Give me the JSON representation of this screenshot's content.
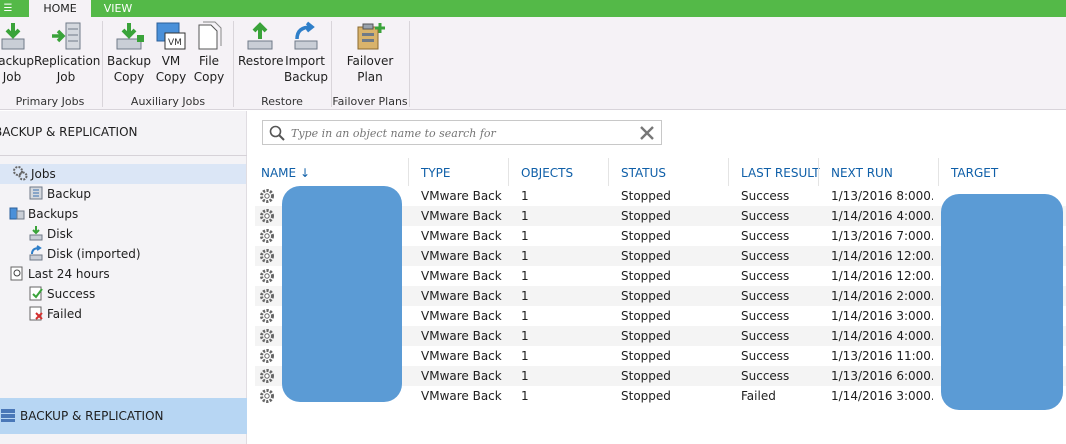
{
  "ribbon": {
    "tabs": [
      {
        "label": "HOME",
        "active": true
      },
      {
        "label": "VIEW",
        "active": false
      }
    ],
    "groups": [
      {
        "label": "Primary Jobs",
        "buttons": [
          {
            "line1": "Backup",
            "line2": "Job",
            "icon": "backup-job-icon"
          },
          {
            "line1": "Replication",
            "line2": "Job",
            "icon": "replication-job-icon"
          }
        ]
      },
      {
        "label": "Auxiliary Jobs",
        "buttons": [
          {
            "line1": "Backup",
            "line2": "Copy",
            "icon": "backup-copy-icon"
          },
          {
            "line1": "VM",
            "line2": "Copy",
            "icon": "vm-copy-icon"
          },
          {
            "line1": "File",
            "line2": "Copy",
            "icon": "file-copy-icon"
          }
        ]
      },
      {
        "label": "Restore",
        "buttons": [
          {
            "line1": "Restore",
            "line2": "",
            "icon": "restore-icon"
          },
          {
            "line1": "Import",
            "line2": "Backup",
            "icon": "import-backup-icon"
          }
        ]
      },
      {
        "label": "Failover Plans",
        "buttons": [
          {
            "line1": "Failover",
            "line2": "Plan",
            "icon": "failover-plan-icon"
          }
        ]
      }
    ]
  },
  "nav": {
    "title": "BACKUP & REPLICATION",
    "tree": [
      {
        "label": "Jobs",
        "icon": "jobs-icon",
        "selected": true
      },
      {
        "label": "Backup",
        "icon": "backup-icon"
      },
      {
        "label": "Backups",
        "icon": "backups-icon"
      },
      {
        "label": "Disk",
        "icon": "disk-icon"
      },
      {
        "label": "Disk (imported)",
        "icon": "disk-imported-icon"
      },
      {
        "label": "Last 24 hours",
        "icon": "last-24-hours-icon"
      },
      {
        "label": "Success",
        "icon": "success-icon"
      },
      {
        "label": "Failed",
        "icon": "failed-icon"
      }
    ],
    "bottom_label": "BACKUP & REPLICATION"
  },
  "search": {
    "placeholder": "Type in an object name to search for"
  },
  "grid": {
    "columns": [
      "NAME",
      "TYPE",
      "OBJECTS",
      "STATUS",
      "LAST RESULT",
      "NEXT RUN",
      "TARGET"
    ],
    "sort_indicator": "↓",
    "rows": [
      {
        "type": "VMware Back...",
        "objects": "1",
        "status": "Stopped",
        "last_result": "Success",
        "next_run": "1/13/2016 8:000..."
      },
      {
        "type": "VMware Back...",
        "objects": "1",
        "status": "Stopped",
        "last_result": "Success",
        "next_run": "1/14/2016 4:000..."
      },
      {
        "type": "VMware Back...",
        "objects": "1",
        "status": "Stopped",
        "last_result": "Success",
        "next_run": "1/13/2016 7:000..."
      },
      {
        "type": "VMware Back...",
        "objects": "1",
        "status": "Stopped",
        "last_result": "Success",
        "next_run": "1/14/2016 12:00..."
      },
      {
        "type": "VMware Back...",
        "objects": "1",
        "status": "Stopped",
        "last_result": "Success",
        "next_run": "1/14/2016 12:00..."
      },
      {
        "type": "VMware Back...",
        "objects": "1",
        "status": "Stopped",
        "last_result": "Success",
        "next_run": "1/14/2016 2:000..."
      },
      {
        "type": "VMware Back...",
        "objects": "1",
        "status": "Stopped",
        "last_result": "Success",
        "next_run": "1/14/2016 3:000..."
      },
      {
        "type": "VMware Back...",
        "objects": "1",
        "status": "Stopped",
        "last_result": "Success",
        "next_run": "1/14/2016 4:000..."
      },
      {
        "type": "VMware Back...",
        "objects": "1",
        "status": "Stopped",
        "last_result": "Success",
        "next_run": "1/13/2016 11:00..."
      },
      {
        "type": "VMware Back...",
        "objects": "1",
        "status": "Stopped",
        "last_result": "Success",
        "next_run": "1/13/2016 6:000..."
      },
      {
        "type": "VMware Back...",
        "objects": "1",
        "status": "Stopped",
        "last_result": "Failed",
        "next_run": "1/14/2016 3:000..."
      }
    ]
  },
  "colors": {
    "accent_green": "#54b948",
    "header_blue": "#0f5fa8",
    "redaction_blue": "#5b9bd5",
    "selection": "#dbe6f6"
  }
}
